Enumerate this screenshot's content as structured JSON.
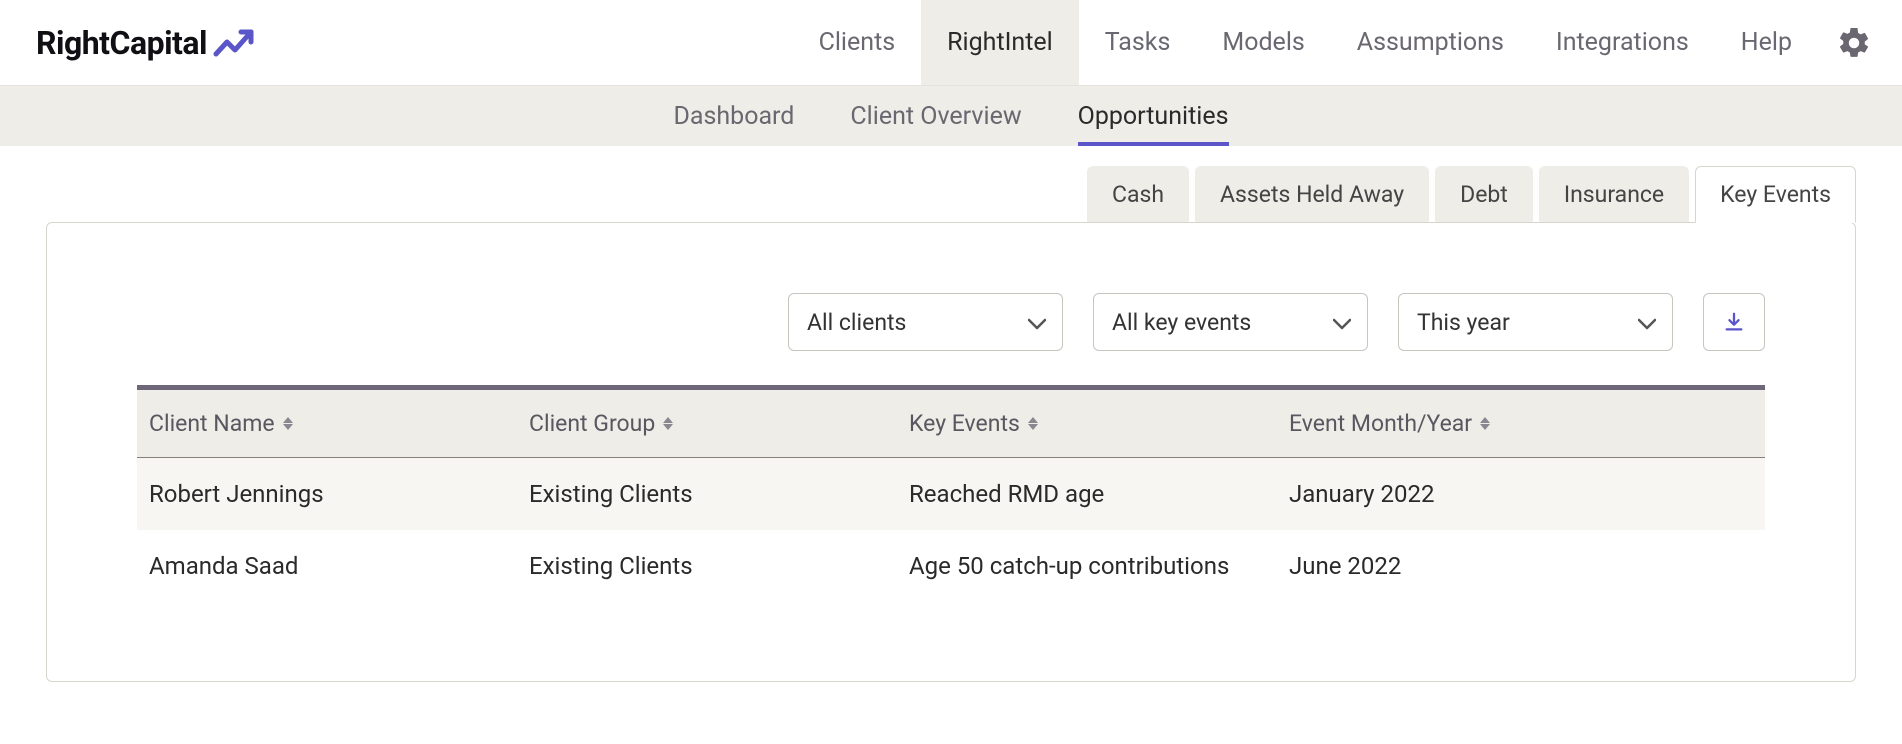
{
  "brand": {
    "name": "RightCapital"
  },
  "topnav": {
    "items": [
      {
        "label": "Clients",
        "active": false
      },
      {
        "label": "RightIntel",
        "active": true
      },
      {
        "label": "Tasks",
        "active": false
      },
      {
        "label": "Models",
        "active": false
      },
      {
        "label": "Assumptions",
        "active": false
      },
      {
        "label": "Integrations",
        "active": false
      },
      {
        "label": "Help",
        "active": false
      }
    ]
  },
  "subnav": {
    "items": [
      {
        "label": "Dashboard",
        "active": false
      },
      {
        "label": "Client Overview",
        "active": false
      },
      {
        "label": "Opportunities",
        "active": true
      }
    ]
  },
  "opptabs": {
    "items": [
      {
        "label": "Cash",
        "active": false
      },
      {
        "label": "Assets Held Away",
        "active": false
      },
      {
        "label": "Debt",
        "active": false
      },
      {
        "label": "Insurance",
        "active": false
      },
      {
        "label": "Key Events",
        "active": true
      }
    ]
  },
  "filters": {
    "clients": "All clients",
    "events": "All key events",
    "period": "This year"
  },
  "table": {
    "headers": {
      "c1": "Client Name",
      "c2": "Client Group",
      "c3": "Key Events",
      "c4": "Event Month/Year"
    },
    "rows": [
      {
        "c1": "Robert Jennings",
        "c2": "Existing Clients",
        "c3": "Reached RMD age",
        "c4": "January 2022"
      },
      {
        "c1": "Amanda Saad",
        "c2": "Existing Clients",
        "c3": "Age 50 catch-up contributions",
        "c4": "June 2022"
      }
    ]
  },
  "colors": {
    "accent": "#5a55c8"
  }
}
